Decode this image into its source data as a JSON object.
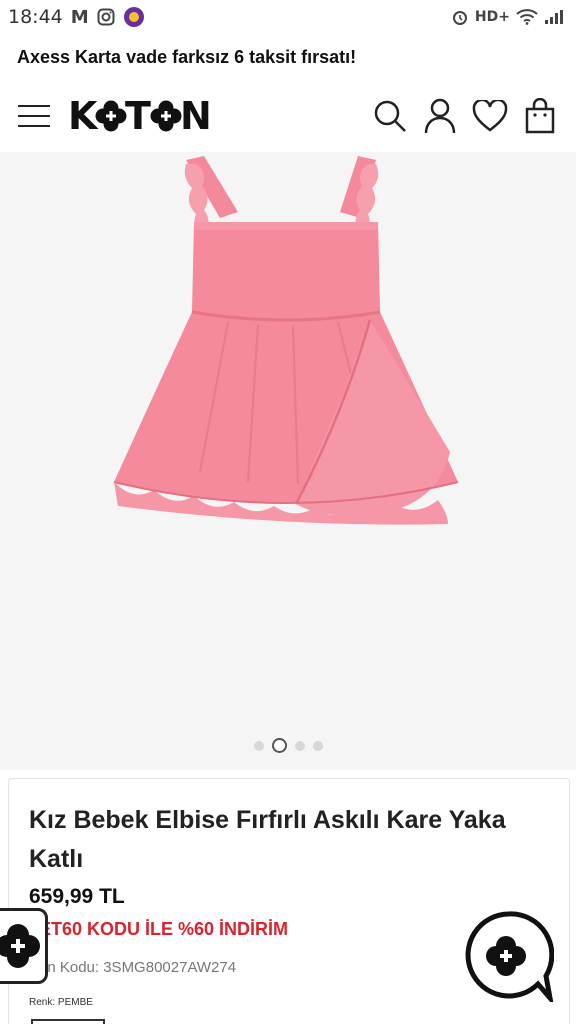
{
  "status_bar": {
    "time": "18:44",
    "network": "HD+"
  },
  "promo_bar": {
    "text": "Axess Karta vade farksız 6 taksit fırsatı!"
  },
  "header": {
    "logo_text": "KOTON",
    "icons": [
      "menu-icon",
      "search-icon",
      "user-icon",
      "heart-icon",
      "bag-icon"
    ]
  },
  "gallery": {
    "slide_count": 4,
    "active_slide": 2
  },
  "product": {
    "title": "Kız Bebek Elbise Fırfırlı Askılı Kare Yaka Katlı",
    "price": "659,99 TL",
    "promo_code": "ET60 KODU İLE %60 İNDİRİM",
    "product_code": "ün Kodu: 3SMG80027AW274",
    "color_label": "Renk: PEMBE"
  },
  "colors": {
    "accent_red": "#d9232e",
    "dress_pink": "#f48a9b"
  }
}
